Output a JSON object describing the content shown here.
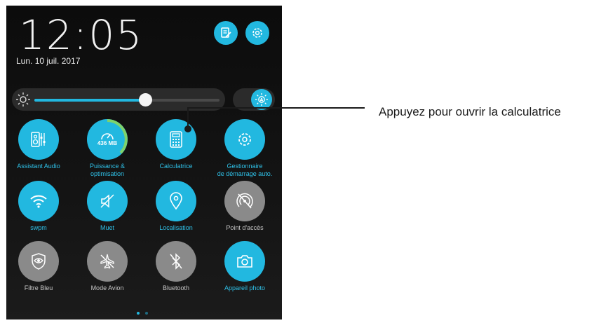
{
  "status": {
    "time": "12:05",
    "date": "Lun. 10 juil. 2017"
  },
  "header_buttons": [
    {
      "icon": "edit-list-icon"
    },
    {
      "icon": "gear-icon"
    }
  ],
  "brightness": {
    "level": 0.6,
    "auto_icon": "auto-brightness-icon"
  },
  "tiles": [
    {
      "label": "Assistant Audio",
      "icon": "speaker-equalizer-icon",
      "state": "on"
    },
    {
      "label": "Puissance & optimisation",
      "label_lines": [
        "Puissance &",
        "optimisation"
      ],
      "icon": "gauge-icon",
      "state": "on",
      "value": "436 MB"
    },
    {
      "label": "Calculatrice",
      "icon": "calculator-icon",
      "state": "on"
    },
    {
      "label": "Gestionnaire de démarrage auto.",
      "label_lines": [
        "Gestionnaire",
        "de démarrage auto."
      ],
      "icon": "gear-icon",
      "state": "on"
    },
    {
      "label": "swpm",
      "icon": "wifi-icon",
      "state": "on"
    },
    {
      "label": "Muet",
      "icon": "mute-icon",
      "state": "on"
    },
    {
      "label": "Localisation",
      "icon": "location-pin-icon",
      "state": "on"
    },
    {
      "label": "Point d'accès",
      "icon": "hotspot-off-icon",
      "state": "off"
    },
    {
      "label": "Filtre Bleu",
      "icon": "eye-shield-icon",
      "state": "off"
    },
    {
      "label": "Mode Avion",
      "icon": "airplane-icon",
      "state": "off"
    },
    {
      "label": "Bluetooth",
      "icon": "bluetooth-off-icon",
      "state": "off"
    },
    {
      "label": "Appareil photo",
      "icon": "camera-icon",
      "state": "on"
    }
  ],
  "pager": {
    "pages": 2,
    "current": 1
  },
  "callout": {
    "text": "Appuyez pour ouvrir la calculatrice"
  },
  "colors": {
    "accent": "#22b8e0",
    "inactive": "#8a8a8a",
    "background": "#141414"
  }
}
